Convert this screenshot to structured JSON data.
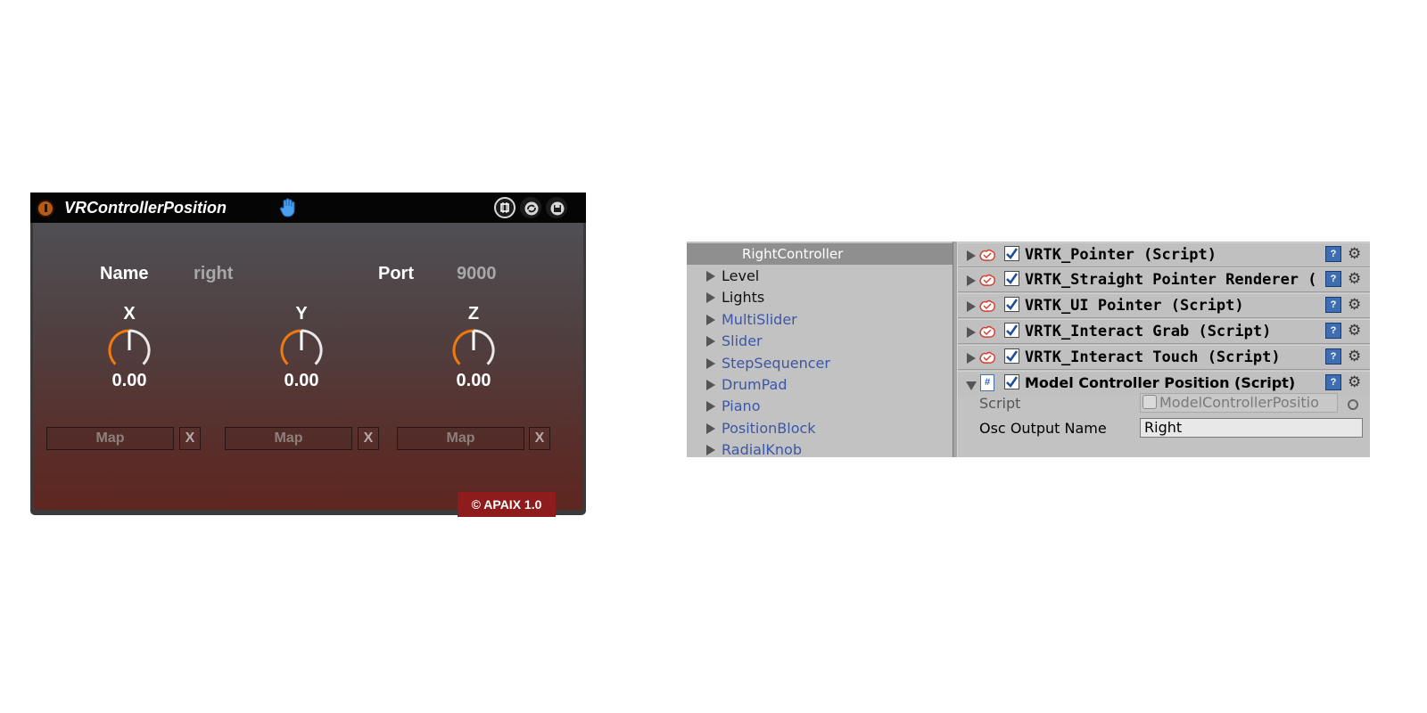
{
  "device": {
    "title": "VRControllerPosition",
    "name_label": "Name",
    "name_value": "right",
    "port_label": "Port",
    "port_value": "9000",
    "knobs": [
      {
        "axis": "X",
        "value": "0.00"
      },
      {
        "axis": "Y",
        "value": "0.00"
      },
      {
        "axis": "Z",
        "value": "0.00"
      }
    ],
    "map_label": "Map",
    "clear_label": "X",
    "footer": "© APAIX 1.0",
    "colors": {
      "knob_arc": "#f07a10",
      "footer_bg": "#8e1c1c"
    }
  },
  "unity": {
    "hierarchy": {
      "selected": "RightController",
      "items": [
        {
          "label": "Level",
          "type": "object"
        },
        {
          "label": "Lights",
          "type": "object"
        },
        {
          "label": "MultiSlider",
          "type": "prefab"
        },
        {
          "label": "Slider",
          "type": "prefab"
        },
        {
          "label": "StepSequencer",
          "type": "prefab"
        },
        {
          "label": "DrumPad",
          "type": "prefab"
        },
        {
          "label": "Piano",
          "type": "prefab"
        },
        {
          "label": "PositionBlock",
          "type": "prefab"
        },
        {
          "label": "RadialKnob",
          "type": "prefab"
        }
      ]
    },
    "components": [
      {
        "name": "VRTK_Pointer (Script)",
        "expanded": false
      },
      {
        "name": "VRTK_Straight Pointer Renderer (",
        "expanded": false
      },
      {
        "name": "VRTK_UI Pointer (Script)",
        "expanded": false
      },
      {
        "name": "VRTK_Interact Grab (Script)",
        "expanded": false
      },
      {
        "name": "VRTK_Interact Touch (Script)",
        "expanded": false
      },
      {
        "name": "Model Controller Position (Script)",
        "expanded": true
      }
    ],
    "properties": {
      "script_label": "Script",
      "script_value": "ModelControllerPositio",
      "osc_label": "Osc Output Name",
      "osc_value": "Right"
    },
    "colors": {
      "prefab_text": "#3b57a8",
      "selected_row": "#8f8f8f"
    }
  }
}
